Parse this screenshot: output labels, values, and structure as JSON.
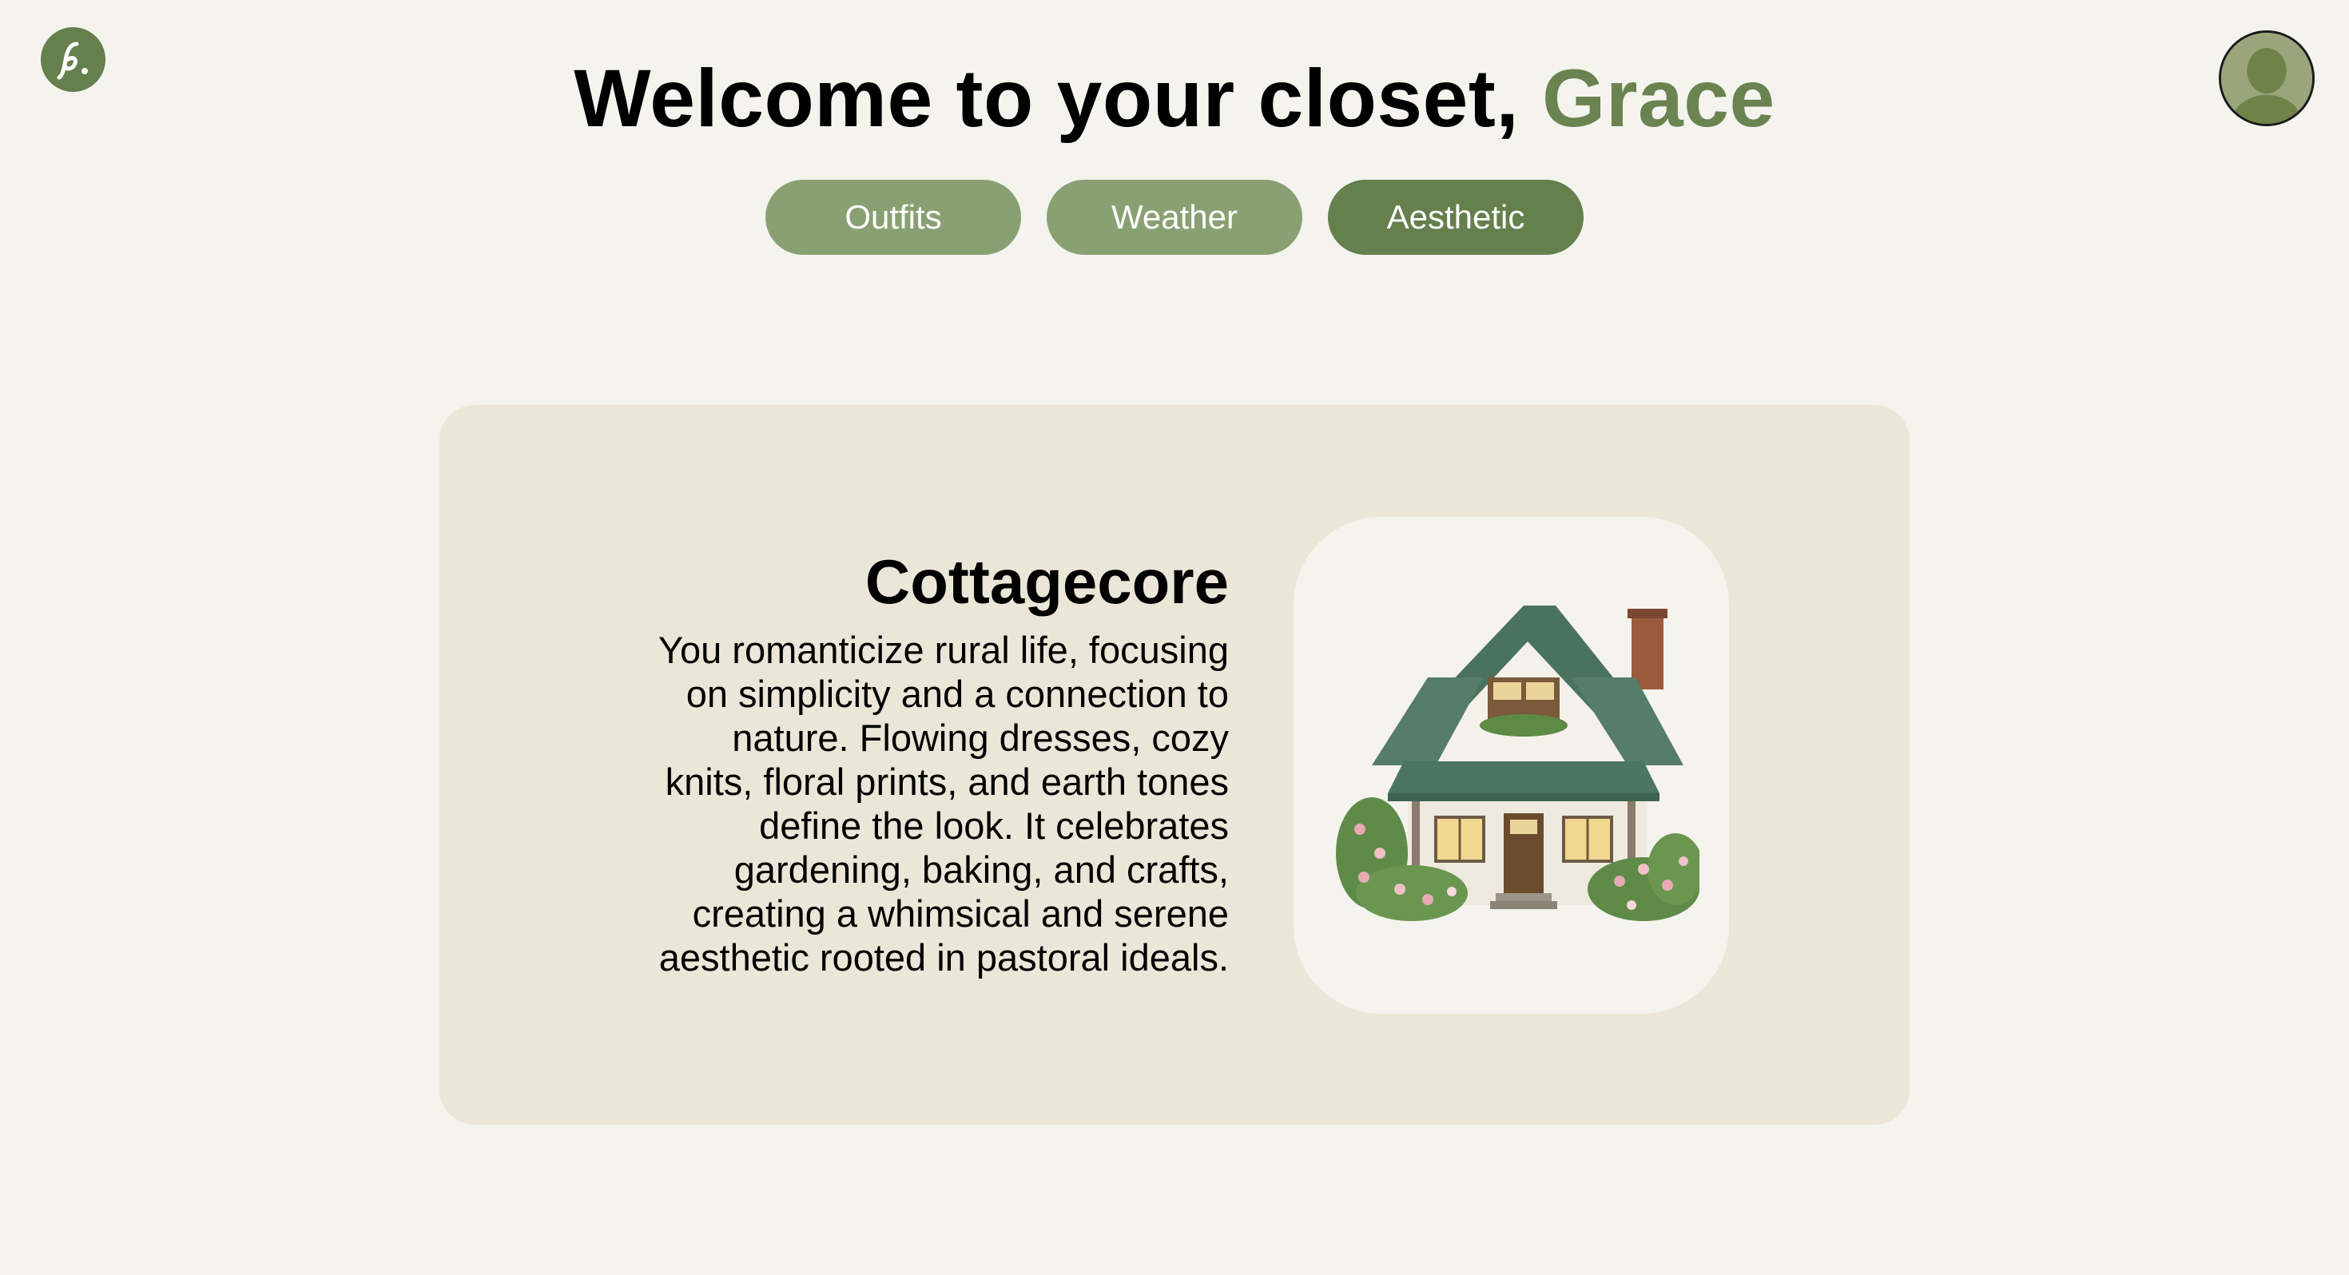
{
  "header": {
    "logo_icon": "script-f-logo-icon",
    "title_prefix": "Welcome to your closet, ",
    "user_name": "Grace",
    "avatar_icon": "user-avatar-icon"
  },
  "tabs": [
    {
      "label": "Outfits",
      "active": false
    },
    {
      "label": "Weather",
      "active": false
    },
    {
      "label": "Aesthetic",
      "active": true
    }
  ],
  "aesthetic_card": {
    "title": "Cottagecore",
    "description": "You romanticize rural life, focusing on simplicity and a connection to nature. Flowing dresses, cozy knits, floral prints, and earth tones define the look. It celebrates gardening, baking, and crafts, creating a whimsical and serene aesthetic rooted in pastoral ideals.",
    "image_icon": "cottage-illustration"
  },
  "colors": {
    "background": "#f4f3ee",
    "accent": "#657f4d",
    "tab_inactive": "#89a073",
    "card_background": "#ebe7d8"
  }
}
